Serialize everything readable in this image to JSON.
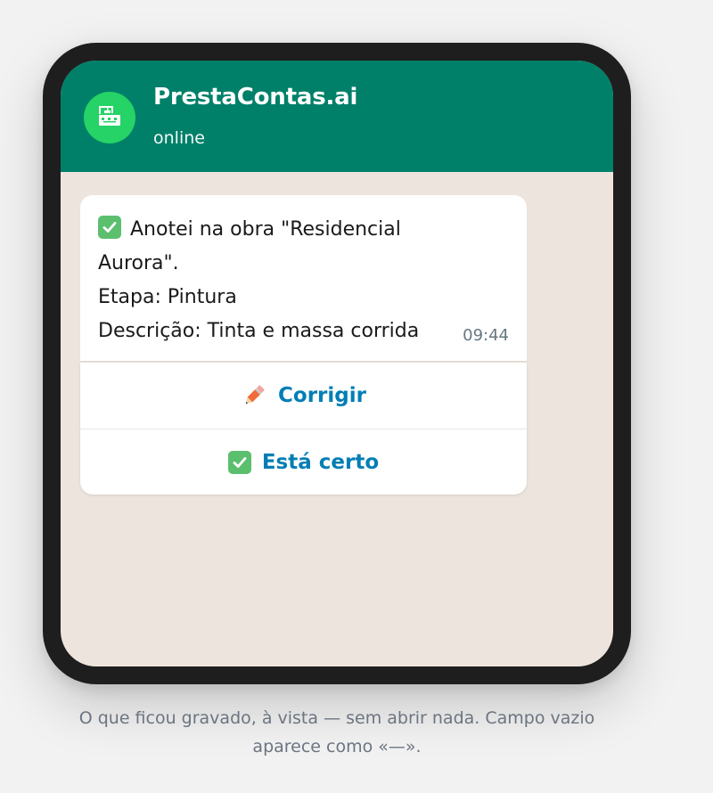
{
  "chat_header": {
    "title": "PrestaContas.ai",
    "status": "online",
    "avatar_icon": "crane-icon",
    "color": "#008069",
    "avatar_color": "#25d366"
  },
  "message": {
    "lines": [
      "Anotei na obra \"Residencial",
      "Aurora\".",
      "Etapa: Pintura",
      "Descrição: Tinta e massa corrida"
    ],
    "leading_icon": "check-mark-button-icon",
    "time": "09:44"
  },
  "actions": [
    {
      "label": "Corrigir",
      "icon": "pencil-icon"
    },
    {
      "label": "Está certo",
      "icon": "check-mark-button-icon"
    }
  ],
  "caption": "O que ficou gravado, à vista — sem abrir nada. Campo vazio aparece como «—».",
  "colors": {
    "chat_background": "#ede5dd",
    "action_text": "#027eb5",
    "phone_frame": "#1e1e1e"
  }
}
